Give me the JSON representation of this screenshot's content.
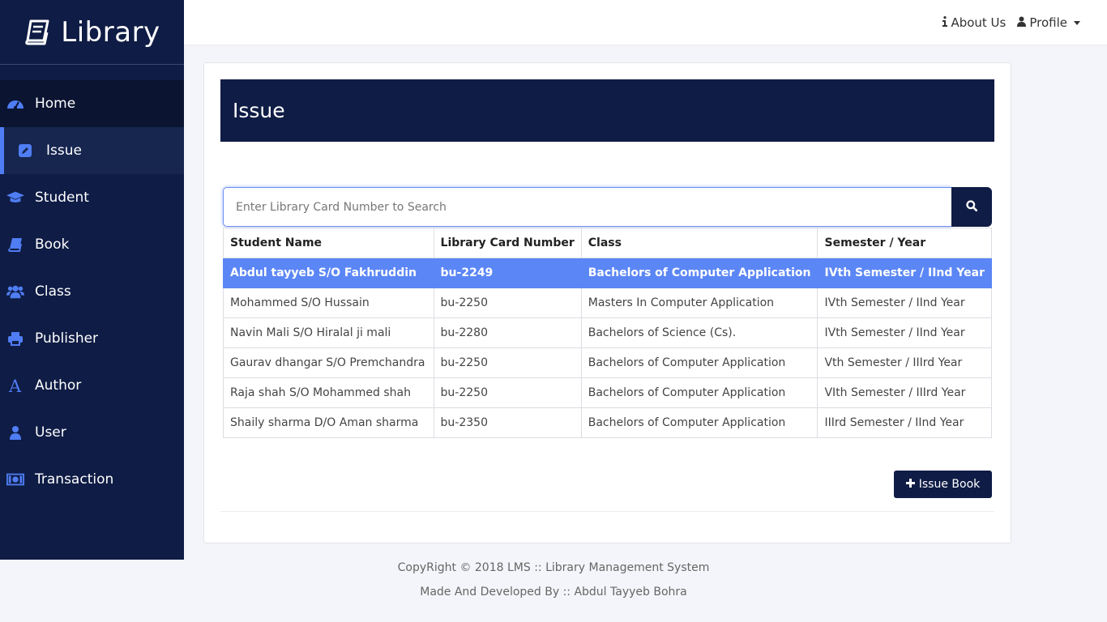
{
  "brand": {
    "name": "Library",
    "icon": "book-icon"
  },
  "sidebar": {
    "items": [
      {
        "label": "Home",
        "icon": "dashboard-icon"
      },
      {
        "label": "Issue",
        "icon": "edit-icon",
        "active": true
      },
      {
        "label": "Student",
        "icon": "graduation-cap-icon"
      },
      {
        "label": "Book",
        "icon": "book-icon"
      },
      {
        "label": "Class",
        "icon": "users-icon"
      },
      {
        "label": "Publisher",
        "icon": "printer-icon"
      },
      {
        "label": "Author",
        "icon": "font-icon"
      },
      {
        "label": "User",
        "icon": "user-icon"
      },
      {
        "label": "Transaction",
        "icon": "money-icon"
      }
    ]
  },
  "topbar": {
    "about_label": "About Us",
    "profile_label": "Profile"
  },
  "panel": {
    "title": "Issue"
  },
  "search": {
    "placeholder": "Enter Library Card Number to Search"
  },
  "table": {
    "headers": [
      "Student Name",
      "Library Card Number",
      "Class",
      "Semester / Year"
    ],
    "rows": [
      [
        "Abdul tayyeb S/O Fakhruddin",
        "bu-2249",
        "Bachelors of Computer Application",
        "IVth Semester / IInd Year"
      ],
      [
        "Mohammed S/O Hussain",
        "bu-2250",
        "Masters In Computer Application",
        "IVth Semester / IInd Year"
      ],
      [
        "Navin Mali S/O Hiralal ji mali",
        "bu-2280",
        "Bachelors of Science (Cs).",
        "IVth Semester / IInd Year"
      ],
      [
        "Gaurav dhangar S/O Premchandra",
        "bu-2250",
        "Bachelors of Computer Application",
        "Vth Semester / IIIrd Year"
      ],
      [
        "Raja shah S/O Mohammed shah",
        "bu-2250",
        "Bachelors of Computer Application",
        "VIth Semester / IIIrd Year"
      ],
      [
        "Shaily sharma D/O Aman sharma",
        "bu-2350",
        "Bachelors of Computer Application",
        "IIIrd Semester / IInd Year"
      ]
    ],
    "selected_row": 0
  },
  "issue_button": {
    "label": "Issue Book"
  },
  "footer": {
    "copyright": "CopyRight © 2018 LMS :: Library Management System",
    "credit": "Made And Developed By :: Abdul Tayyeb Bohra"
  },
  "colors": {
    "sidebar": "#0f1c45",
    "accent": "#4f7df3",
    "selected_row": "#5b86f5"
  }
}
